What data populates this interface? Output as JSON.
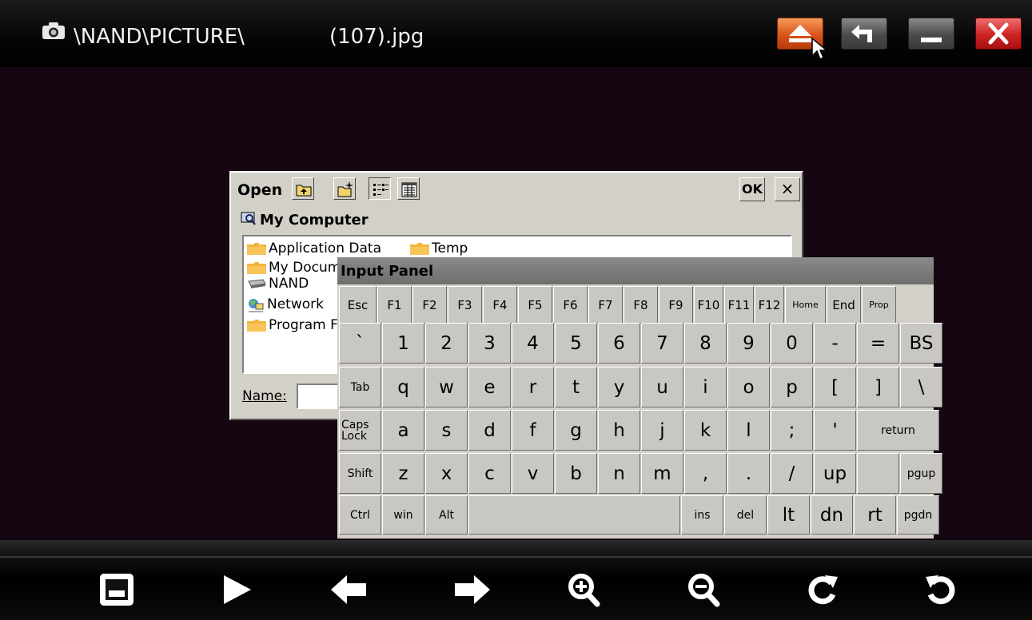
{
  "titlebar": {
    "path": "\\NAND\\PICTURE\\",
    "filename": "(107).jpg",
    "camera_icon": "camera-icon",
    "buttons": [
      "eject-icon",
      "back-arrow-icon",
      "minimize-icon",
      "close-icon"
    ]
  },
  "open_dialog": {
    "label": "Open",
    "toolbar_icons": [
      "up-folder-icon",
      "new-folder-icon",
      "list-view-icon",
      "details-view-icon"
    ],
    "ok_label": "OK",
    "close_label": "×",
    "location": "My Computer",
    "items": [
      {
        "label": "Application Data",
        "icon": "folder-icon"
      },
      {
        "label": "Temp",
        "icon": "folder-icon"
      },
      {
        "label": "My Docum",
        "icon": "folder-icon"
      },
      {
        "label": "NAND",
        "icon": "drive-icon"
      },
      {
        "label": "Network",
        "icon": "network-icon"
      },
      {
        "label": "Program F",
        "icon": "folder-icon"
      }
    ],
    "name_label": "Name:",
    "name_value": ""
  },
  "input_panel": {
    "title": "Input Panel",
    "rows": [
      [
        "Esc",
        "F1",
        "F2",
        "F3",
        "F4",
        "F5",
        "F6",
        "F7",
        "F8",
        "F9",
        "F10",
        "F11",
        "F12",
        "Home",
        "End",
        "Prop"
      ],
      [
        "`",
        "1",
        "2",
        "3",
        "4",
        "5",
        "6",
        "7",
        "8",
        "9",
        "0",
        "-",
        "=",
        "BS"
      ],
      [
        "Tab",
        "q",
        "w",
        "e",
        "r",
        "t",
        "y",
        "u",
        "i",
        "o",
        "p",
        "[",
        "]",
        "\\"
      ],
      [
        "Caps Lock",
        "a",
        "s",
        "d",
        "f",
        "g",
        "h",
        "j",
        "k",
        "l",
        ";",
        "'",
        "return"
      ],
      [
        "Shift",
        "z",
        "x",
        "c",
        "v",
        "b",
        "n",
        "m",
        ",",
        ".",
        "/",
        "up",
        "",
        "pgup"
      ],
      [
        "Ctrl",
        "win",
        "Alt",
        "",
        "ins",
        "del",
        "lt",
        "dn",
        "rt",
        "pgdn"
      ]
    ]
  },
  "bottom_toolbar": {
    "icons": [
      "slideshow-frame-icon",
      "play-icon",
      "previous-arrow-icon",
      "next-arrow-icon",
      "zoom-in-icon",
      "zoom-out-icon",
      "rotate-right-icon",
      "rotate-left-icon"
    ]
  }
}
